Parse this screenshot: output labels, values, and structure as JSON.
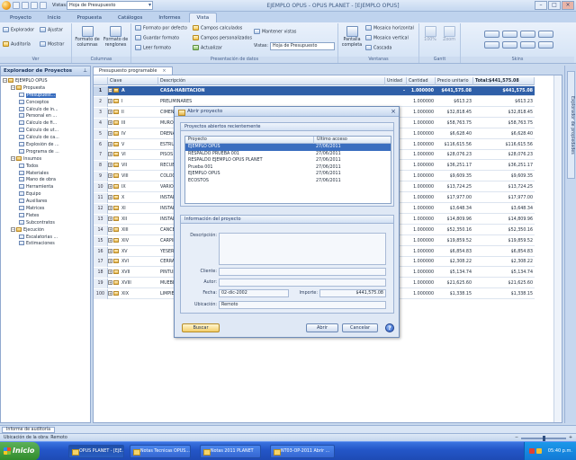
{
  "titlebar": {
    "view_label": "Vistas:",
    "view_value": "Hoja de Presupuesto",
    "app_title": "EJEMPLO OPUS - OPUS PLANET - [EJEMPLO OPUS]"
  },
  "ribbon": {
    "tabs": [
      "Proyecto",
      "Inicio",
      "Propuesta",
      "Catálogos",
      "Informes",
      "Vista"
    ],
    "groups": {
      "ver": {
        "label": "Ver",
        "explorador": "Explorador",
        "auditoria": "Auditoría",
        "ajustar": "Ajustar",
        "mostrar": "Mostrar"
      },
      "columnas": {
        "label": "Columnas",
        "formato_columnas": "Formato de columnas",
        "formato_renglones": "Formato de renglones"
      },
      "presentacion": {
        "label": "Presentación de datos",
        "formato_defecto": "Formato por defecto",
        "guardar_formato": "Guardar formato",
        "leer_formato": "Leer formato",
        "campos_calculados": "Campos calculados",
        "campos_personalizados": "Campos personalizados",
        "actualizar": "Actualizar",
        "mantener_vistas": "Mantener vistas",
        "vistas_label": "Vistas:",
        "vistas_value": "Hoja de Presupuesto"
      },
      "ventanas": {
        "label": "Ventanas",
        "pantalla_completa": "Pantalla completa",
        "mosaico_horizontal": "Mosaico horizontal",
        "mosaico_vertical": "Mosaico vertical",
        "cascada": "Cascada"
      },
      "gantt": {
        "label": "Gantt",
        "zoom_pct": "100%",
        "zoom": "Zoom"
      },
      "skins": {
        "label": "Skins"
      }
    }
  },
  "explorer": {
    "title": "Explorador de Proyectos",
    "items": [
      {
        "label": "EJEMPLO OPUS",
        "level": 0
      },
      {
        "label": "Propuesta",
        "level": 1
      },
      {
        "label": "Presupuest...",
        "level": 2,
        "selected": true
      },
      {
        "label": "Conceptos",
        "level": 2
      },
      {
        "label": "Cálculo de in...",
        "level": 2
      },
      {
        "label": "Personal en ...",
        "level": 2
      },
      {
        "label": "Cálculo de fi...",
        "level": 2
      },
      {
        "label": "Cálculo de ut...",
        "level": 2
      },
      {
        "label": "Cálculo de ca...",
        "level": 2
      },
      {
        "label": "Explosión de ...",
        "level": 2
      },
      {
        "label": "Programa de ...",
        "level": 2
      },
      {
        "label": "Insumos",
        "level": 1
      },
      {
        "label": "Todos",
        "level": 2
      },
      {
        "label": "Materiales",
        "level": 2
      },
      {
        "label": "Mano de obra",
        "level": 2
      },
      {
        "label": "Herramienta",
        "level": 2
      },
      {
        "label": "Equipo",
        "level": 2
      },
      {
        "label": "Auxiliares",
        "level": 2
      },
      {
        "label": "Matrices",
        "level": 2
      },
      {
        "label": "Fletes",
        "level": 2
      },
      {
        "label": "Subcontratos",
        "level": 2
      },
      {
        "label": "Ejecución",
        "level": 1
      },
      {
        "label": "Escalatorias ...",
        "level": 2
      },
      {
        "label": "Estimaciones",
        "level": 2
      }
    ]
  },
  "right_panel": {
    "label": "Explorador de propiedades"
  },
  "document": {
    "tab_label": "Presupuesto programable",
    "columns": [
      "Clave",
      "Descripción",
      "Unidad",
      "Cantidad",
      "Precio unitario",
      "Total:$441,575.08"
    ],
    "rows": [
      {
        "n": "1",
        "clave": "A",
        "desc": "CASA-HABITACION",
        "unidad": "-",
        "cantidad": "1.000000",
        "pu": "$441,575.08",
        "total": "$441,575.08"
      },
      {
        "n": "2",
        "clave": "I",
        "desc": "PRELIMINARES",
        "unidad": "",
        "cantidad": "1.000000",
        "pu": "$613.23",
        "total": "$613.23"
      },
      {
        "n": "3",
        "clave": "II",
        "desc": "CIMENTACION",
        "unidad": "",
        "cantidad": "1.000000",
        "pu": "$32,818.45",
        "total": "$32,818.45"
      },
      {
        "n": "4",
        "clave": "III",
        "desc": "MUROS",
        "unidad": "",
        "cantidad": "1.000000",
        "pu": "$58,763.75",
        "total": "$58,763.75"
      },
      {
        "n": "5",
        "clave": "IV",
        "desc": "DRENAJE",
        "unidad": "",
        "cantidad": "1.000000",
        "pu": "$6,628.40",
        "total": "$6,628.40"
      },
      {
        "n": "6",
        "clave": "V",
        "desc": "ESTRUCTURA",
        "unidad": "",
        "cantidad": "1.000000",
        "pu": "$116,615.56",
        "total": "$116,615.56"
      },
      {
        "n": "7",
        "clave": "VI",
        "desc": "PISOS",
        "unidad": "",
        "cantidad": "1.000000",
        "pu": "$28,076.23",
        "total": "$28,076.23"
      },
      {
        "n": "8",
        "clave": "VII",
        "desc": "RECUBRIMIENTOS",
        "unidad": "",
        "cantidad": "1.000000",
        "pu": "$36,251.17",
        "total": "$36,251.17"
      },
      {
        "n": "9",
        "clave": "VIII",
        "desc": "COLOCACIONES",
        "unidad": "",
        "cantidad": "1.000000",
        "pu": "$9,609.35",
        "total": "$9,609.35"
      },
      {
        "n": "10",
        "clave": "IX",
        "desc": "VARIOS",
        "unidad": "",
        "cantidad": "1.000000",
        "pu": "$13,724.25",
        "total": "$13,724.25"
      },
      {
        "n": "11",
        "clave": "X",
        "desc": "INSTALACION",
        "unidad": "",
        "cantidad": "1.000000",
        "pu": "$17,977.00",
        "total": "$17,977.00"
      },
      {
        "n": "12",
        "clave": "XI",
        "desc": "INSTALACION",
        "unidad": "",
        "cantidad": "1.000000",
        "pu": "$3,648.34",
        "total": "$3,648.34"
      },
      {
        "n": "13",
        "clave": "XII",
        "desc": "INSTALACION",
        "unidad": "",
        "cantidad": "1.000000",
        "pu": "$14,809.96",
        "total": "$14,809.96"
      },
      {
        "n": "14",
        "clave": "XIII",
        "desc": "CANCELERIA",
        "unidad": "",
        "cantidad": "1.000000",
        "pu": "$52,350.16",
        "total": "$52,350.16"
      },
      {
        "n": "15",
        "clave": "XIV",
        "desc": "CARPINTERIA",
        "unidad": "",
        "cantidad": "1.000000",
        "pu": "$19,859.52",
        "total": "$19,859.52"
      },
      {
        "n": "16",
        "clave": "XV",
        "desc": "YESERIA",
        "unidad": "",
        "cantidad": "1.000000",
        "pu": "$6,854.83",
        "total": "$6,854.83"
      },
      {
        "n": "17",
        "clave": "XVI",
        "desc": "CERRAJERIA",
        "unidad": "",
        "cantidad": "1.000000",
        "pu": "$2,308.22",
        "total": "$2,308.22"
      },
      {
        "n": "18",
        "clave": "XVII",
        "desc": "PINTURA",
        "unidad": "",
        "cantidad": "1.000000",
        "pu": "$5,134.74",
        "total": "$5,134.74"
      },
      {
        "n": "19",
        "clave": "XVIII",
        "desc": "MUEBLES",
        "unidad": "",
        "cantidad": "1.000000",
        "pu": "$21,625.60",
        "total": "$21,625.60"
      },
      {
        "n": "100",
        "clave": "XIX",
        "desc": "LIMPIEZA",
        "unidad": "",
        "cantidad": "1.000000",
        "pu": "$1,338.15",
        "total": "$1,338.15"
      }
    ]
  },
  "dialog": {
    "title": "Abrir proyecto",
    "recent_legend": "Proyectos abiertos recientemente",
    "list_headers": {
      "proyecto": "Proyecto",
      "ultimo": "Último acceso"
    },
    "recent": [
      {
        "name": "EJEMPLO OPUS",
        "date": "27/06/2011",
        "selected": true
      },
      {
        "name": "RESPALDO PRUEBA 001",
        "date": "27/06/2011"
      },
      {
        "name": "RESPALDO EJEMPLO OPUS PLANET",
        "date": "27/06/2011"
      },
      {
        "name": "Prueba 001",
        "date": "27/06/2011"
      },
      {
        "name": "EJEMPLO OPUS",
        "date": "27/06/2011"
      },
      {
        "name": "ECOSTOS",
        "date": "27/06/2011"
      }
    ],
    "info_legend": "Información del proyecto",
    "fields": {
      "descripcion_label": "Descripción:",
      "cliente_label": "Cliente:",
      "autor_label": "Autor:",
      "fecha_label": "Fecha:",
      "fecha_value": "02-dic-2002",
      "importe_label": "Importe:",
      "importe_value": "$441,575.08",
      "ubicacion_label": "Ubicación:",
      "ubicacion_value": "Remoto"
    },
    "buttons": {
      "buscar": "Buscar",
      "abrir": "Abrir",
      "cancelar": "Cancelar",
      "help": "?"
    }
  },
  "audit_bar": {
    "tab_label": "Informe de auditoría"
  },
  "status_bar": {
    "text": "Ubicación de la obra: Remoto"
  },
  "taskbar": {
    "start": "Inicio",
    "items": [
      "OPUS PLANET - [EJE...",
      "Notas Tecnicas OPUS...",
      "Notas 2011 PLANET",
      "NT03-OP-2011 Abrir ..."
    ],
    "clock": "05:40 p.m."
  },
  "colors": {
    "ribbon_bg": "#d3e2f5",
    "selection": "#2f5fa8",
    "taskbar": "#2457c9",
    "start_green": "#2e8a2a"
  }
}
